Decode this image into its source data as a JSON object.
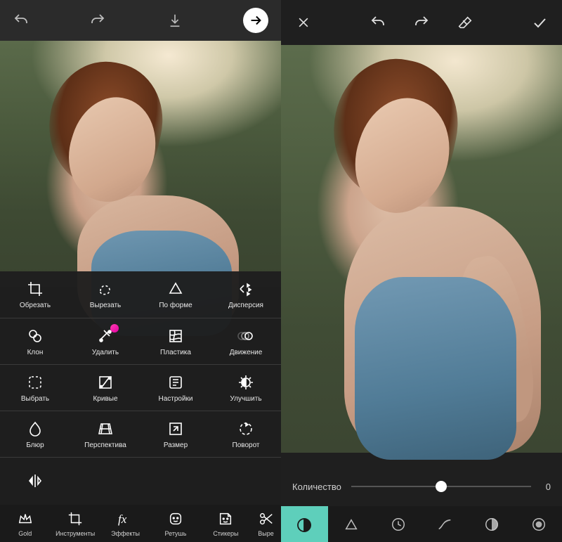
{
  "colors": {
    "accent": "#5ecfbb",
    "badge": "#ff3db0"
  },
  "left": {
    "topbar": {
      "undo": "undo",
      "redo": "redo",
      "download": "download",
      "forward": "forward"
    },
    "tools": {
      "r1": [
        "Обрезать",
        "Вырезать",
        "По форме",
        "Дисперсия"
      ],
      "r2": [
        "Клон",
        "Удалить",
        "Пластика",
        "Движение"
      ],
      "r3": [
        "Выбрать",
        "Кривые",
        "Настройки",
        "Улучшить"
      ],
      "r4": [
        "Блюр",
        "Перспектива",
        "Размер",
        "Поворот"
      ]
    },
    "ribbon": [
      "Gold",
      "Инструменты",
      "Эффекты",
      "Ретушь",
      "Стикеры",
      "Выре"
    ]
  },
  "right": {
    "topbar": {
      "close": "close",
      "undo": "undo",
      "redo": "redo",
      "eraser": "eraser",
      "apply": "apply"
    },
    "slider": {
      "label": "Количество",
      "value": "0"
    },
    "fx_icons": [
      "contrast",
      "triangle",
      "clock",
      "curves",
      "shadows",
      "circle"
    ]
  }
}
